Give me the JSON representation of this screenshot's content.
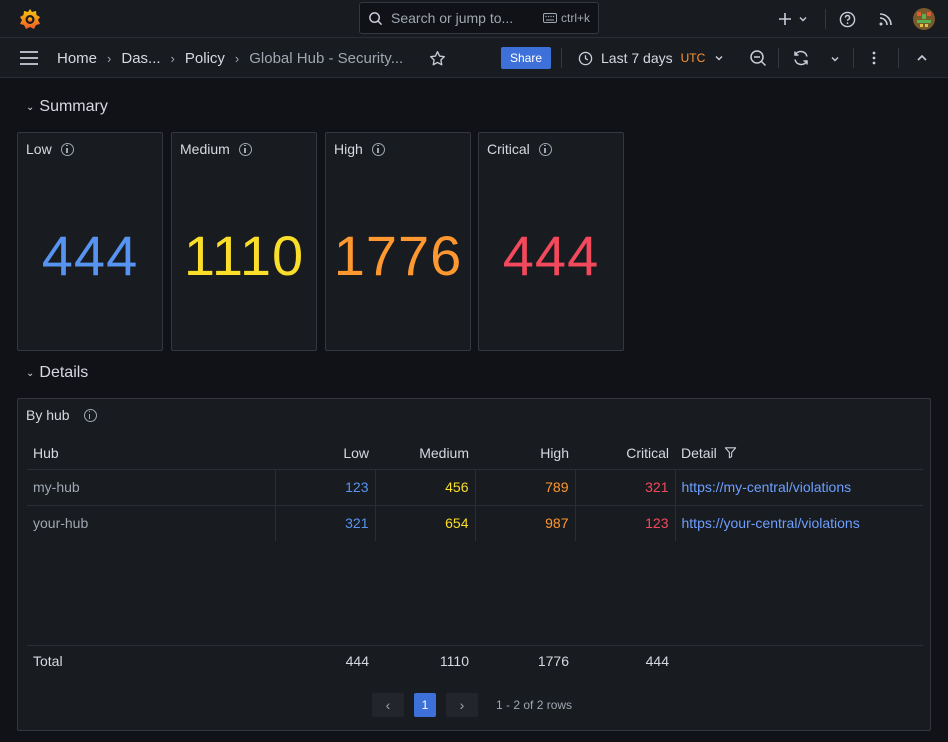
{
  "search": {
    "placeholder": "Search or jump to...",
    "shortcut": "ctrl+k"
  },
  "breadcrumbs": [
    "Home",
    "Das...",
    "Policy",
    "Global Hub - Security..."
  ],
  "toolbar": {
    "share_label": "Share",
    "time_range": "Last 7 days",
    "timezone": "UTC"
  },
  "colors": {
    "low": "#5794f2",
    "medium": "#fade2a",
    "high": "#ff9830",
    "critical": "#f2495c",
    "accent": "#3d71d9"
  },
  "rows": {
    "summary": "Summary",
    "details": "Details"
  },
  "stats": [
    {
      "label": "Low",
      "value": "444"
    },
    {
      "label": "Medium",
      "value": "1110"
    },
    {
      "label": "High",
      "value": "1776"
    },
    {
      "label": "Critical",
      "value": "444"
    }
  ],
  "table": {
    "title": "By hub",
    "headers": {
      "hub": "Hub",
      "low": "Low",
      "medium": "Medium",
      "high": "High",
      "critical": "Critical",
      "detail": "Detail"
    },
    "rows": [
      {
        "hub": "my-hub",
        "low": "123",
        "medium": "456",
        "high": "789",
        "critical": "321",
        "detail": "https://my-central/violations"
      },
      {
        "hub": "your-hub",
        "low": "321",
        "medium": "654",
        "high": "987",
        "critical": "123",
        "detail": "https://your-central/violations"
      }
    ],
    "footer": {
      "label": "Total",
      "low": "444",
      "medium": "1110",
      "high": "1776",
      "critical": "444"
    }
  },
  "pagination": {
    "current": "1",
    "info": "1 - 2 of 2 rows"
  }
}
